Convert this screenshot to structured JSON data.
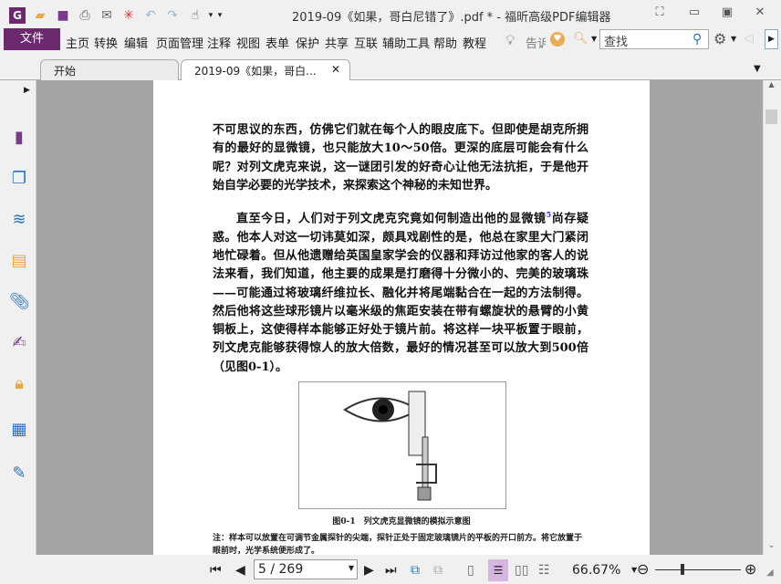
{
  "window": {
    "title": "2019-09《如果，哥白尼错了》.pdf * - 福昕高级PDF编辑器"
  },
  "menu": {
    "file": "文件",
    "items": [
      "主页",
      "转换",
      "编辑",
      "页面管理",
      "注释",
      "视图",
      "表单",
      "保护",
      "共享",
      "互联",
      "辅助工具",
      "帮助",
      "教程"
    ],
    "tell_me": "告诉",
    "search_placeholder": "查找"
  },
  "tabs": [
    {
      "label": "开始"
    },
    {
      "label": "2019-09《如果，哥白..."
    }
  ],
  "document": {
    "paragraphs": [
      "不可思议的东西，仿佛它们就在每个人的眼皮底下。但即使是胡克所拥有的最好的显微镜，也只能放大10～50倍。更深的底层可能会有什么呢？对列文虎克来说，这一谜团引发的好奇心让他无法抗拒，于是他开始自学必要的光学技术，来探索这个神秘的未知世界。",
      "直至今日，人们对于列文虎克究竟如何制造出他的显微镜",
      "尚存疑惑。他本人对这一切讳莫如深，颇具戏剧性的是，他总在家里大门紧闭地忙碌着。但从他遗赠给英国皇家学会的仪器和拜访过他家的客人的说法来看，我们知道，他主要的成果是打磨得十分微小的、完美的玻璃珠——可能通过将玻璃纤维拉长、融化并将尾端黏合在一起的方法制得。然后他将这些球形镜片以毫米级的焦距安装在带有螺旋状的悬臂的小黄铜板上，这使得样本能够正好处于镜片前。将这样一块平板置于眼前，列文虎克能够获得惊人的放大倍数，最好的情况甚至可以放大到500倍（见图0-1）。"
    ],
    "footnote_ref": "5",
    "figure_caption": "图0-1　列文虎克显微镜的模拟示意图",
    "figure_note": "注：样本可以放置在可调节金属探针的尖端，探针正处于固定玻璃镜片的平板的开口前方。将它放置于眼前时，光学系统便形成了。"
  },
  "status": {
    "page_input": "5 / 269",
    "zoom": "66.67%"
  },
  "colors": {
    "accent": "#6b2a6e",
    "canvas": "#a5a5a5"
  }
}
